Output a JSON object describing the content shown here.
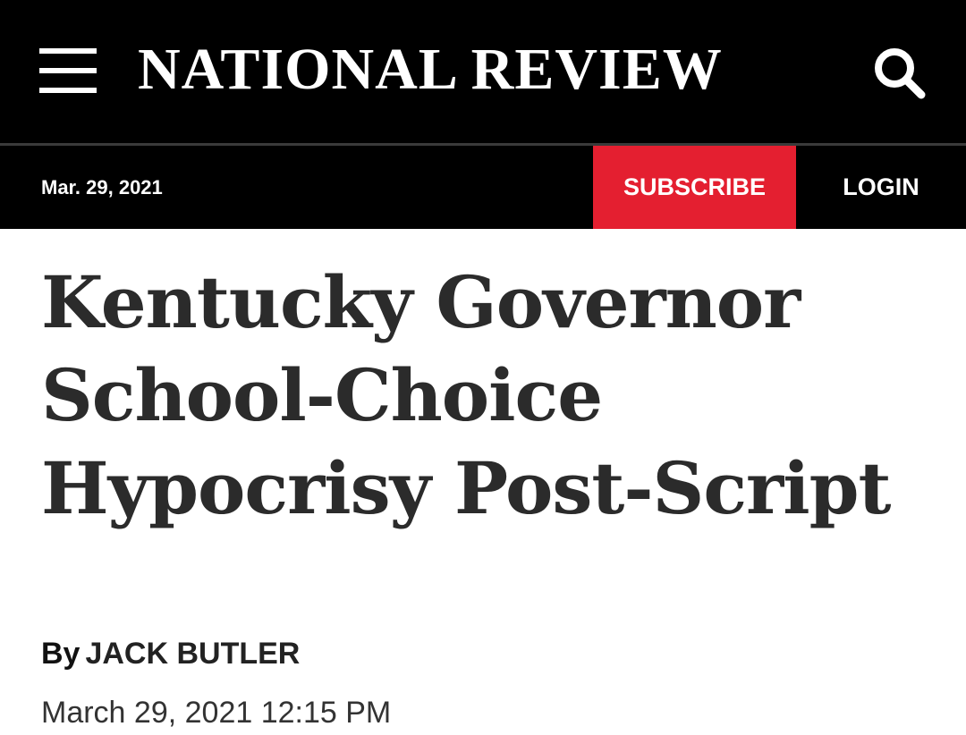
{
  "header": {
    "menu_icon": "hamburger-menu-icon",
    "logo_text": "NATIONAL REVIEW",
    "search_icon": "search-icon"
  },
  "subbar": {
    "date": "Mar. 29, 2021",
    "subscribe_label": "SUBSCRIBE",
    "login_label": "LOGIN"
  },
  "article": {
    "headline": "Kentucky Governor School-Choice Hypocrisy Post-Script",
    "byline_prefix": "By",
    "author": "JACK BUTLER",
    "timestamp": "March 29, 2021 12:15 PM"
  },
  "colors": {
    "header_bg": "#000000",
    "subscribe_bg": "#e41f30",
    "headline_text": "#2b2b2b"
  }
}
